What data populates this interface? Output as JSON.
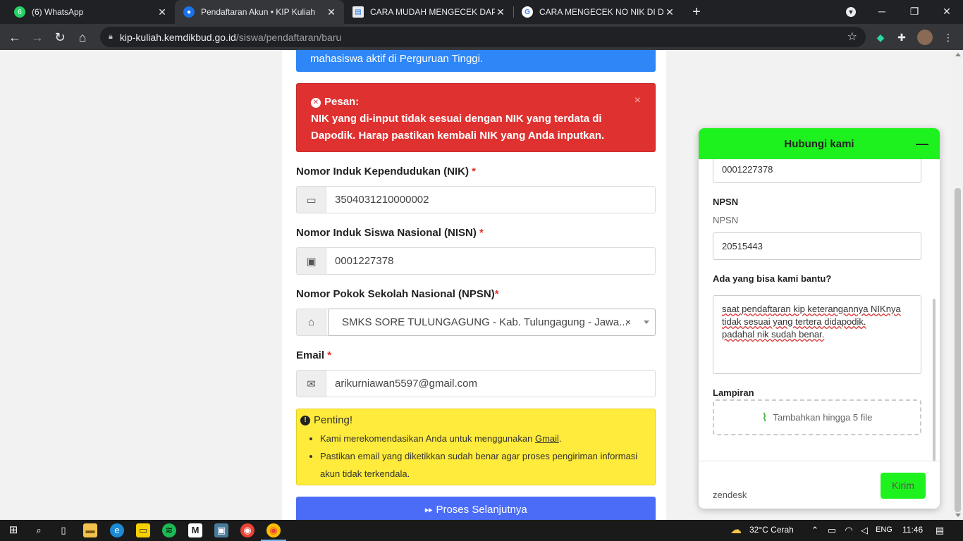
{
  "browser": {
    "tabs": [
      {
        "label": "(6) WhatsApp",
        "badge": "6",
        "favicon": "whatsapp-icon"
      },
      {
        "label": "Pendaftaran Akun • KIP Kuliah",
        "favicon": "kip-icon"
      },
      {
        "label": "CARA MUDAH MENGECEK DAPO",
        "favicon": "doc-icon"
      },
      {
        "label": "CARA MENGECEK NO NIK DI DA",
        "favicon": "google-icon"
      }
    ],
    "url_domain": "kip-kuliah.kemdikbud.go.id",
    "url_path": "/siswa/pendaftaran/baru"
  },
  "form": {
    "info_banner": "mahasiswa aktif di Perguruan Tinggi.",
    "error": {
      "title": "Pesan:",
      "message": "NIK yang di-input tidak sesuai dengan NIK yang terdata di Dapodik. Harap pastikan kembali NIK yang Anda inputkan.",
      "close": "×"
    },
    "nik": {
      "label": "Nomor Induk Kependudukan (NIK)",
      "required": "*",
      "value": "3504031210000002"
    },
    "nisn": {
      "label": "Nomor Induk Siswa Nasional (NISN)",
      "required": "*",
      "value": "0001227378"
    },
    "npsn": {
      "label": "Nomor Pokok Sekolah Nasional (NPSN)",
      "required": "*",
      "value": "SMKS SORE TULUNGAGUNG - Kab. Tulungagung - Jawa...",
      "clear": "×"
    },
    "email": {
      "label": "Email",
      "required": "*",
      "value": "arikurniawan5597@gmail.com"
    },
    "notice": {
      "title": "Penting!",
      "item1_prefix": "Kami merekomendasikan Anda untuk menggunakan ",
      "item1_link": "Gmail",
      "item1_suffix": ".",
      "item2": "Pastikan email yang diketikkan sudah benar agar proses pengiriman informasi akun tidak terkendala."
    },
    "submit": "Proses Selanjutnya"
  },
  "widget": {
    "title": "Hubungi kami",
    "nisn_value": "0001227378",
    "npsn_label": "NPSN",
    "npsn_hint": "NPSN",
    "npsn_value": "20515443",
    "help_label": "Ada yang bisa kami bantu?",
    "message_line1": "saat pendaftaran kip keterangannya NIKnya",
    "message_line2": "tidak sesuai yang tertera didapodik.",
    "message_line3": "padahal nik sudah benar.",
    "attach_label": "Lampiran",
    "attach_button": "Tambahkan hingga 5 file",
    "brand": "zendesk",
    "send": "Kirim"
  },
  "taskbar": {
    "weather": "32°C  Cerah",
    "lang": "ENG",
    "time": "11:46"
  },
  "colors": {
    "error_bg": "#e03131",
    "warning_bg": "#ffeb3b",
    "primary_button": "#4a6cf7",
    "widget_accent": "#1ef21e"
  }
}
